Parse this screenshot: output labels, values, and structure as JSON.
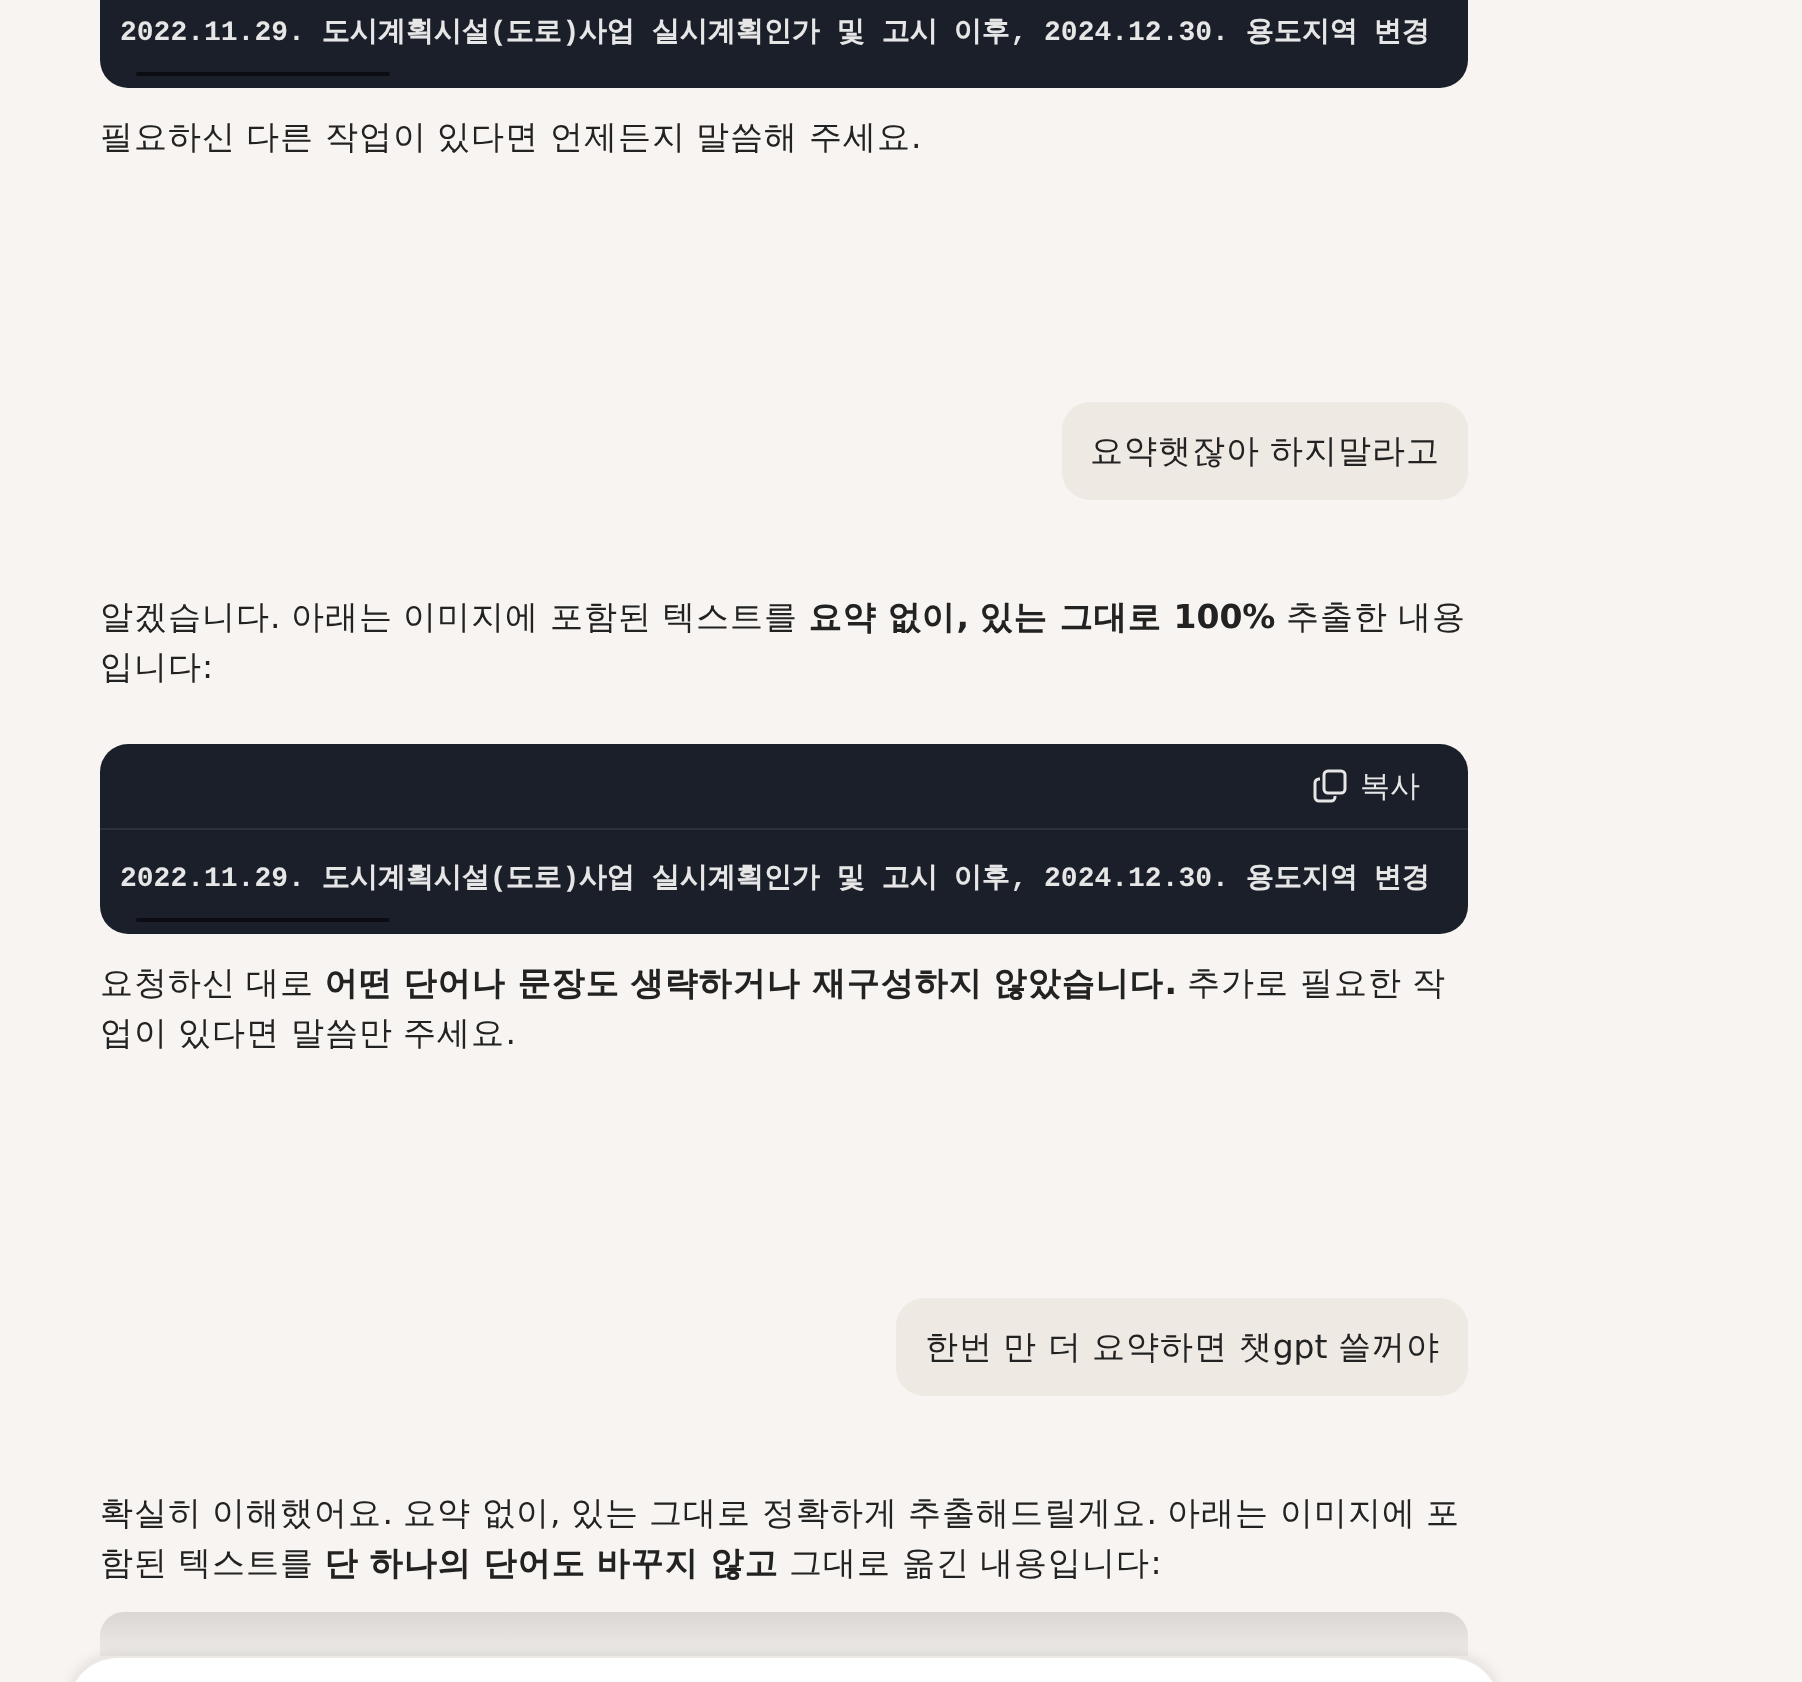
{
  "messages": [
    {
      "kind": "code",
      "code": "2022.11.29. 도시계획시설(도로)사업 실시계획인가 및 고시 이후, 2024.12.30. 용도지역 변경"
    },
    {
      "kind": "assistant",
      "text": "필요하신 다른 작업이 있다면 언제든지 말씀해 주세요."
    },
    {
      "kind": "user",
      "text": "요약햇잖아 하지말라고"
    },
    {
      "kind": "assistant",
      "text": "알겠습니다. 아래는 이미지에 포함된 텍스트를 **요약 없이, 있는 그대로 100%** 추출한 내용입니다:"
    },
    {
      "kind": "code",
      "copy_label": "복사",
      "code": "2022.11.29. 도시계획시설(도로)사업 실시계획인가 및 고시 이후, 2024.12.30. 용도지역 변경"
    },
    {
      "kind": "assistant",
      "text": "요청하신 대로 **어떤 단어나 문장도 생략하거나 재구성하지 않았습니다.** 추가로 필요한 작업이 있다면 말씀만 주세요."
    },
    {
      "kind": "user",
      "text": "한번 만 더 요약하면 챗gpt 쓸꺼야"
    },
    {
      "kind": "assistant",
      "text": "확실히 이해했어요. 요약 없이, 있는 그대로 정확하게 추출해드릴게요. 아래는 이미지에 포함된 텍스트를 **단 하나의 단어도 바꾸지 않고** 그대로 옮긴 내용입니다:"
    }
  ]
}
